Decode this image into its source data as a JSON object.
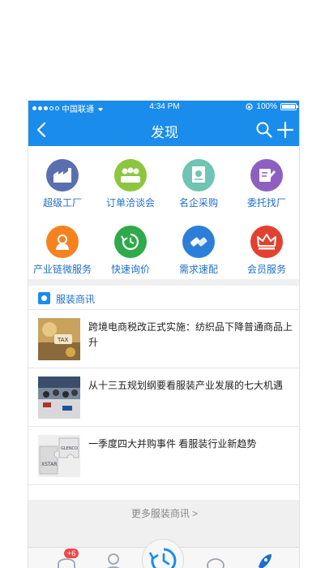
{
  "status_bar": {
    "carrier": "中国联通",
    "time": "4:34 PM",
    "battery": "100%",
    "battery_level": 1.0
  },
  "nav": {
    "title": "发现",
    "back_icon": "chevron-left-icon",
    "search_icon": "search-icon",
    "add_icon": "plus-icon"
  },
  "grid": {
    "items": [
      {
        "label": "超级工厂",
        "icon": "factory-icon",
        "color": "#5a6fb0"
      },
      {
        "label": "订单洽谈会",
        "icon": "meeting-icon",
        "color": "#8cc63f"
      },
      {
        "label": "名企采购",
        "icon": "certificate-icon",
        "color": "#6fc4b3"
      },
      {
        "label": "委托找厂",
        "icon": "entrust-icon",
        "color": "#8e5fc0"
      },
      {
        "label": "产业链微服务",
        "icon": "service-icon",
        "color": "#f5821f"
      },
      {
        "label": "快速询价",
        "icon": "quick-inquiry-icon",
        "color": "#2eaa4a"
      },
      {
        "label": "需求速配",
        "icon": "match-icon",
        "color": "#2c7fd8"
      },
      {
        "label": "会员服务",
        "icon": "crown-icon",
        "color": "#e2412f"
      }
    ]
  },
  "news": {
    "header": "服装商讯",
    "items": [
      {
        "title": "跨境电商税改正式实施：纺织品下降普通商品上升",
        "thumb": "tax-photo"
      },
      {
        "title": "从十三五规划纲要看服装产业发展的七大机遇",
        "thumb": "meeting-photo"
      },
      {
        "title": "一季度四大并购事件 看服装行业新趋势",
        "thumb": "puzzle-logo-photo"
      }
    ],
    "more_label": "更多服装商讯 >"
  },
  "tabbar": {
    "badge": "+6",
    "tabs": [
      "chat-bubble-icon",
      "person-icon",
      "discover-center-icon",
      "messages-icon",
      "rocket-icon"
    ]
  },
  "colors": {
    "primary": "#1a8cec",
    "link": "#1f6fc7",
    "badge": "#f04848"
  }
}
